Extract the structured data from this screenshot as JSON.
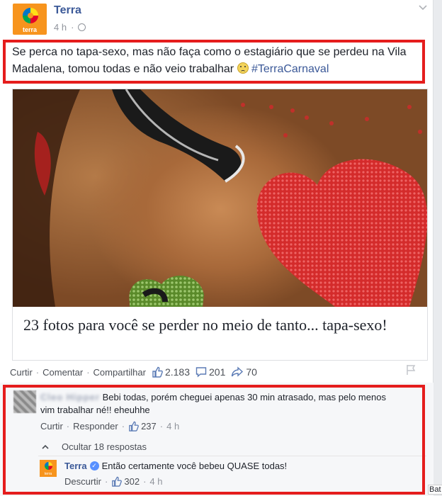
{
  "post": {
    "page_name": "Terra",
    "logo_text": "terra",
    "time": "4 h",
    "text_main": "Se perca no tapa-sexo, mas não faça como o estagiário que se perdeu na Vila Madalena, tomou todas e não veio trabalhar ",
    "hashtag": "#TerraCarnaval"
  },
  "link": {
    "title": "23 fotos para você se perder no meio de tanto... tapa-sexo!"
  },
  "actions": {
    "like": "Curtir",
    "comment": "Comentar",
    "share": "Compartilhar",
    "likes_count": "2.183",
    "comments_count": "201",
    "shares_count": "70"
  },
  "comment1": {
    "author": "Cleo Hipper",
    "text": "Bebi todas, porém cheguei apenas 30 min atrasado, mas pelo menos vim trabalhar né!! eheuhhe",
    "like": "Curtir",
    "reply": "Responder",
    "likes": "237",
    "time": "4 h"
  },
  "replies_toggle": {
    "label": "Ocultar 18 respostas"
  },
  "reply1": {
    "author": "Terra",
    "text": "Então certamente você bebeu QUASE todas!",
    "unlike": "Descurtir",
    "likes": "302",
    "time": "4 h"
  },
  "edge_text": "Bat",
  "colors": {
    "link_blue": "#3b5998",
    "highlight_red": "#e51d1d",
    "brand_orange": "#f7941d"
  }
}
